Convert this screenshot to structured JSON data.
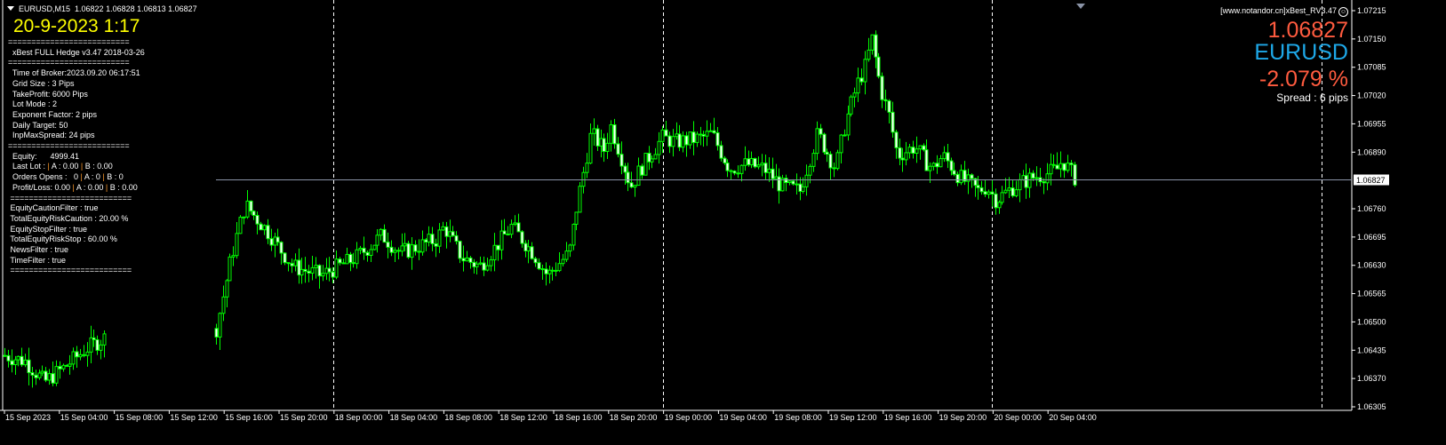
{
  "header": {
    "symbol_tf": "EURUSD,M15",
    "ohlc": "1.06822 1.06828 1.06813 1.06827"
  },
  "clock": "20-9-2023 1:17",
  "info_lines": [
    "==========================",
    "  xBest FULL Hedge v3.47 2018-03-26",
    "==========================",
    "  Time of Broker:2023.09.20 06:17:51",
    "  Grid Size : 3 Pips",
    "  TakeProfit: 6000 Pips",
    "  Lot Mode : 2",
    "  Exponent Factor: 2 pips",
    "  Daily Target: 50",
    "  InpMaxSpread: 24 pips",
    "==========================",
    "  Equity:      4999.41",
    "  Last Lot : | A : 0.00 | B : 0.00",
    "  Orders Opens :   0 | A : 0 | B : 0",
    "  Profit/Loss: 0.00 | A : 0.00 | B : 0.00",
    " ==========================",
    " EquityCautionFilter : true",
    " TotalEquityRiskCaution : 20.00 %",
    " EquityStopFilter : true",
    " TotalEquityRiskStop : 60.00 %",
    " NewsFilter : true",
    " TimeFilter : true",
    " =========================="
  ],
  "right_panel": {
    "brand": "[www.notandor.cn]xBest_RV3.47",
    "smile_icon": "☺",
    "price": "1.06827",
    "symbol": "EURUSD",
    "percent": "-2.079 %",
    "spread": "Spread : 6 pips"
  },
  "colors": {
    "candle": "#00ff00",
    "bid_line": "#8a93a6",
    "bull_fill": "#000000",
    "bear_fill": "#ffffff"
  },
  "chart_data": {
    "type": "candlestick",
    "symbol": "EURUSD",
    "timeframe": "M15",
    "current_price": 1.06827,
    "ylim": [
      1.06305,
      1.07215
    ],
    "price_ticks": [
      "1.07215",
      "1.07150",
      "1.07085",
      "1.07020",
      "1.06955",
      "1.06890",
      "1.06760",
      "1.06695",
      "1.06630",
      "1.06565",
      "1.06500",
      "1.06435",
      "1.06370",
      "1.06305"
    ],
    "current_label": "1.06827",
    "time_ticks": [
      "15 Sep 2023",
      "15 Sep 04:00",
      "15 Sep 08:00",
      "15 Sep 12:00",
      "15 Sep 16:00",
      "15 Sep 20:00",
      "18 Sep 00:00",
      "18 Sep 04:00",
      "18 Sep 08:00",
      "18 Sep 12:00",
      "18 Sep 16:00",
      "18 Sep 20:00",
      "19 Sep 00:00",
      "19 Sep 04:00",
      "19 Sep 08:00",
      "19 Sep 12:00",
      "19 Sep 16:00",
      "19 Sep 20:00",
      "20 Sep 00:00",
      "20 Sep 04:00"
    ],
    "day_separators_hours": [
      24,
      48,
      72,
      96
    ],
    "segments_hours_price": [
      [
        [
          0,
          1.06423
        ],
        [
          1.5,
          1.0641
        ],
        [
          2.9,
          1.06362
        ],
        [
          4.5,
          1.064
        ],
        [
          6,
          1.0644
        ],
        [
          7.3,
          1.06464
        ]
      ],
      [
        [
          15.4,
          1.06485
        ],
        [
          16.5,
          1.06648
        ],
        [
          17.5,
          1.0677
        ],
        [
          19.1,
          1.06709
        ],
        [
          21,
          1.06627
        ],
        [
          23,
          1.06607
        ],
        [
          24.3,
          1.06627
        ],
        [
          25.6,
          1.06648
        ],
        [
          27.5,
          1.06699
        ],
        [
          28.8,
          1.06658
        ],
        [
          31.4,
          1.06689
        ],
        [
          32,
          1.06719
        ],
        [
          33.3,
          1.06648
        ],
        [
          34.6,
          1.06627
        ],
        [
          36.9,
          1.06719
        ],
        [
          38.5,
          1.06658
        ],
        [
          39.5,
          1.06607
        ],
        [
          41.1,
          1.06658
        ],
        [
          41.7,
          1.0677
        ],
        [
          42.7,
          1.06933
        ],
        [
          43.7,
          1.06893
        ],
        [
          44.1,
          1.06954
        ],
        [
          45.6,
          1.06811
        ],
        [
          46.3,
          1.06852
        ],
        [
          47.9,
          1.06923
        ],
        [
          48.9,
          1.06913
        ],
        [
          50.8,
          1.06923
        ],
        [
          51.5,
          1.06933
        ],
        [
          52.1,
          1.06893
        ],
        [
          52.8,
          1.06852
        ],
        [
          54,
          1.06862
        ],
        [
          55.3,
          1.06852
        ],
        [
          56.6,
          1.06811
        ],
        [
          57.9,
          1.06801
        ],
        [
          58.6,
          1.06872
        ],
        [
          59.2,
          1.06933
        ],
        [
          60.5,
          1.06852
        ],
        [
          61.2,
          1.06954
        ],
        [
          62.1,
          1.07046
        ],
        [
          62.8,
          1.07097
        ],
        [
          63.1,
          1.07158
        ],
        [
          63.8,
          1.07035
        ],
        [
          64.4,
          1.06974
        ],
        [
          65,
          1.06882
        ],
        [
          66.3,
          1.06903
        ],
        [
          67,
          1.06872
        ],
        [
          67.6,
          1.06852
        ],
        [
          68.3,
          1.06882
        ],
        [
          69.6,
          1.06831
        ],
        [
          70.9,
          1.06801
        ],
        [
          71.5,
          1.06811
        ],
        [
          72.2,
          1.0678
        ],
        [
          73.5,
          1.06811
        ],
        [
          74.8,
          1.06831
        ],
        [
          76,
          1.06842
        ],
        [
          76.7,
          1.06852
        ],
        [
          77,
          1.06872
        ],
        [
          78,
          1.06827
        ]
      ]
    ]
  }
}
